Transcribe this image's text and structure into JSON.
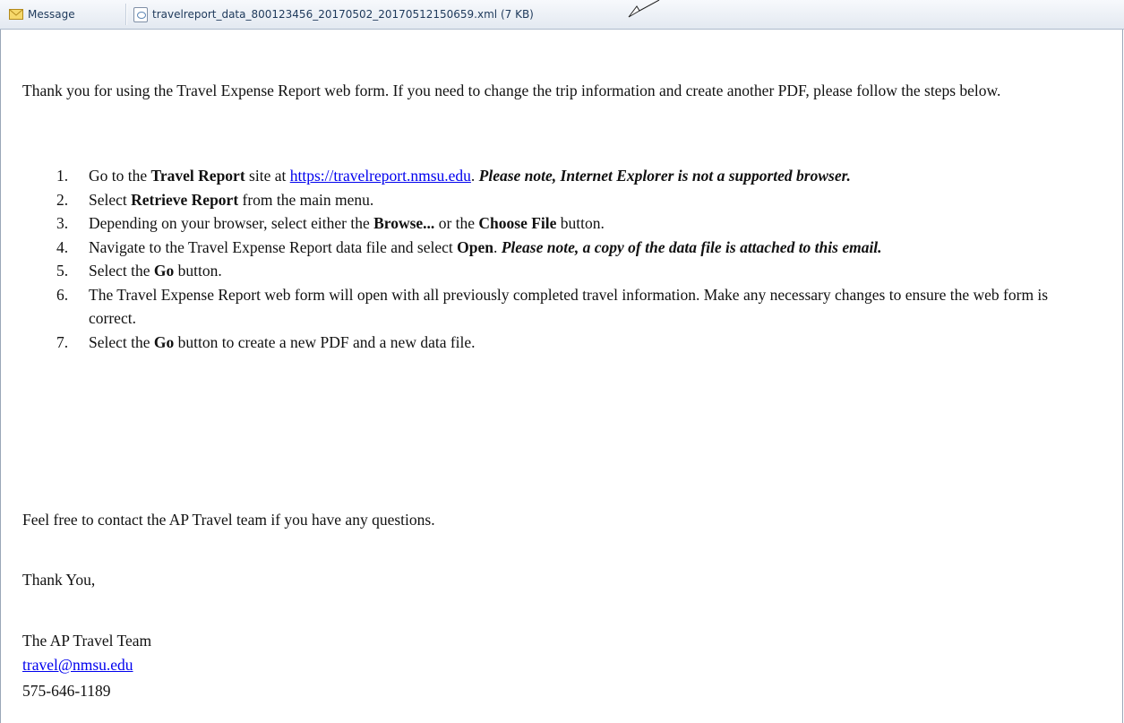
{
  "tabbar": {
    "message_tab": {
      "label": "Message",
      "icon": "envelope-icon"
    },
    "attachment_tab": {
      "filename": "travelreport_data_800123456_20170502_20170512150659.xml",
      "size": "(7 KB)",
      "icon": "xml-document-icon"
    }
  },
  "body": {
    "intro": "Thank you for using the Travel Expense Report web form. If you need to change the trip information and create another PDF, please follow the steps below.",
    "steps": [
      {
        "num": "1.",
        "parts": [
          {
            "t": "Go to the "
          },
          {
            "t": "Travel Report",
            "s": "b"
          },
          {
            "t": " site at "
          },
          {
            "t": "https://travelreport.nmsu.edu",
            "s": "link"
          },
          {
            "t": ". "
          },
          {
            "t": "Please note, Internet Explorer is not a supported browser.",
            "s": "bi"
          }
        ]
      },
      {
        "num": "2.",
        "parts": [
          {
            "t": "Select "
          },
          {
            "t": "Retrieve Report",
            "s": "b"
          },
          {
            "t": " from the main menu."
          }
        ]
      },
      {
        "num": "3.",
        "parts": [
          {
            "t": "Depending on your browser, select either the "
          },
          {
            "t": "Browse...",
            "s": "b"
          },
          {
            "t": " or the "
          },
          {
            "t": "Choose File",
            "s": "b"
          },
          {
            "t": " button."
          }
        ]
      },
      {
        "num": "4.",
        "parts": [
          {
            "t": "Navigate to the Travel Expense Report data file and select "
          },
          {
            "t": "Open",
            "s": "b"
          },
          {
            "t": ". "
          },
          {
            "t": "Please note, a copy of the data file is attached to this email.",
            "s": "bi"
          }
        ]
      },
      {
        "num": "5.",
        "parts": [
          {
            "t": "Select the "
          },
          {
            "t": "Go",
            "s": "b"
          },
          {
            "t": " button."
          }
        ]
      },
      {
        "num": "6.",
        "parts": [
          {
            "t": "The Travel Expense Report web form will open with all previously completed travel information. Make any necessary changes to ensure the web form is correct."
          }
        ]
      },
      {
        "num": "7.",
        "parts": [
          {
            "t": "Select the "
          },
          {
            "t": "Go",
            "s": "b"
          },
          {
            "t": " button to create a new PDF and a new data file."
          }
        ]
      }
    ],
    "closing": "Feel free to contact the AP Travel team if you have any questions.",
    "thanks": "Thank You,",
    "signature": {
      "team": "The AP Travel Team",
      "email": "travel@nmsu.edu",
      "phone": "575-646-1189"
    }
  },
  "colors": {
    "link": "#0000ee",
    "tabbar_text": "#1e395b"
  }
}
